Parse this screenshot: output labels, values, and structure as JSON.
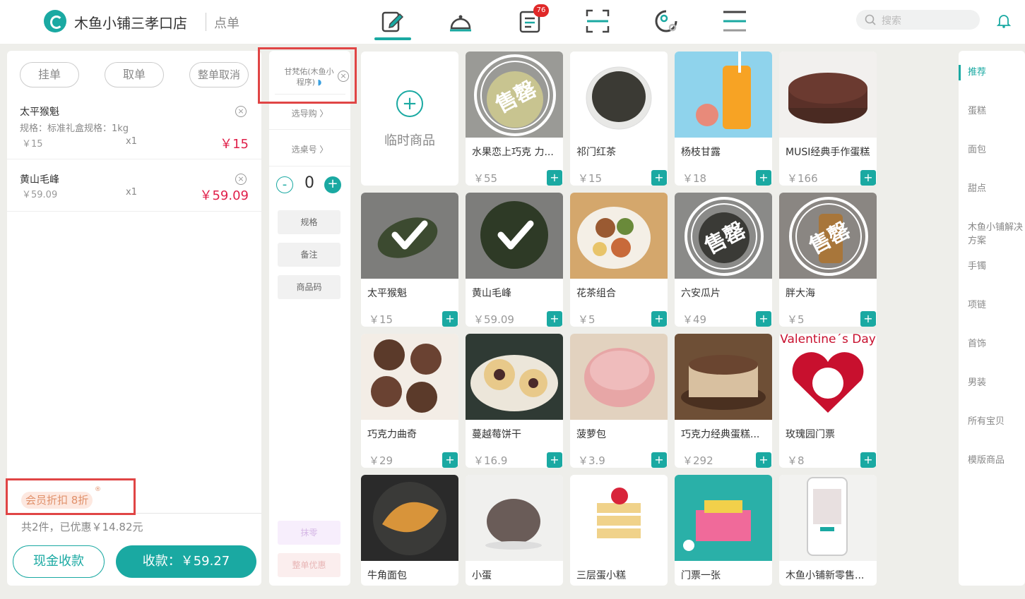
{
  "header": {
    "store_name": "木鱼小铺三孝口店",
    "page_name": "点单",
    "badge_count": "76",
    "search_placeholder": "搜索",
    "nav_icons": [
      "order-icon",
      "service-icon",
      "list-icon",
      "scan-icon",
      "member-icon",
      "menu-icon"
    ]
  },
  "order_panel": {
    "actions": [
      "挂单",
      "取单",
      "整单取消"
    ],
    "items": [
      {
        "name": "太平猴魁",
        "spec": "规格：标准礼盒规格：1kg",
        "price": "￥15",
        "qty": "x1",
        "total": "￥15"
      },
      {
        "name": "黄山毛峰",
        "spec": "",
        "price": "￥59.09",
        "qty": "x1",
        "total": "￥59.09"
      }
    ],
    "member_discount": "会员折扣 8折",
    "summary": "共2件，已优惠￥14.82元",
    "cash_button": "现金收款",
    "pay_button": "收款：￥59.27"
  },
  "middle_panel": {
    "member_name": "甘梵佑(木鱼小程序)",
    "shopping_guide": "选导购",
    "table_number": "选桌号",
    "quantity": "0",
    "buttons": [
      "规格",
      "备注",
      "商品码"
    ],
    "disabled_buttons": [
      "抹零",
      "整单优惠"
    ]
  },
  "products": {
    "temp_label": "临时商品",
    "sold_out_text": "售罄",
    "valentine_text": "Valentine´s Day",
    "items": [
      {
        "name": "水果恋上巧克 力...",
        "price": "￥55",
        "status": "soldout"
      },
      {
        "name": "祁门红茶",
        "price": "￥15",
        "status": "normal"
      },
      {
        "name": "杨枝甘露",
        "price": "￥18",
        "status": "normal"
      },
      {
        "name": "MUSI经典手作蛋糕",
        "price": "￥166",
        "status": "normal"
      },
      {
        "name": "太平猴魁",
        "price": "￥15",
        "status": "selected"
      },
      {
        "name": "黄山毛峰",
        "price": "￥59.09",
        "status": "selected"
      },
      {
        "name": "花茶组合",
        "price": "￥5",
        "status": "normal"
      },
      {
        "name": "六安瓜片",
        "price": "￥49",
        "status": "soldout"
      },
      {
        "name": "胖大海",
        "price": "￥5",
        "status": "soldout"
      },
      {
        "name": "巧克力曲奇",
        "price": "￥29",
        "status": "normal"
      },
      {
        "name": "蔓越莓饼干",
        "price": "￥16.9",
        "status": "normal"
      },
      {
        "name": "菠萝包",
        "price": "￥3.9",
        "status": "normal"
      },
      {
        "name": "巧克力经典蛋糕...",
        "price": "￥292",
        "status": "normal"
      },
      {
        "name": "玫瑰园门票",
        "price": "￥8",
        "status": "normal"
      },
      {
        "name": "牛角面包",
        "price": "",
        "status": "normal"
      },
      {
        "name": "小蛋",
        "price": "",
        "status": "normal"
      },
      {
        "name": "三层蛋小糕",
        "price": "",
        "status": "normal"
      },
      {
        "name": "门票一张",
        "price": "",
        "status": "normal"
      },
      {
        "name": "木鱼小铺新零售...",
        "price": "",
        "status": "normal"
      }
    ]
  },
  "categories": [
    {
      "label": "推荐",
      "active": true
    },
    {
      "label": "蛋糕",
      "active": false
    },
    {
      "label": "面包",
      "active": false
    },
    {
      "label": "甜点",
      "active": false
    },
    {
      "label": "木鱼小铺解决方案",
      "active": false
    },
    {
      "label": "手镯",
      "active": false
    },
    {
      "label": "项链",
      "active": false
    },
    {
      "label": "首饰",
      "active": false
    },
    {
      "label": "男装",
      "active": false
    },
    {
      "label": "所有宝贝",
      "active": false
    },
    {
      "label": "模版商品",
      "active": false
    }
  ],
  "colors": {
    "accent": "#1aa9a2",
    "price_red": "#e0204a",
    "badge_red": "#e02828",
    "highlight": "#e04545"
  }
}
